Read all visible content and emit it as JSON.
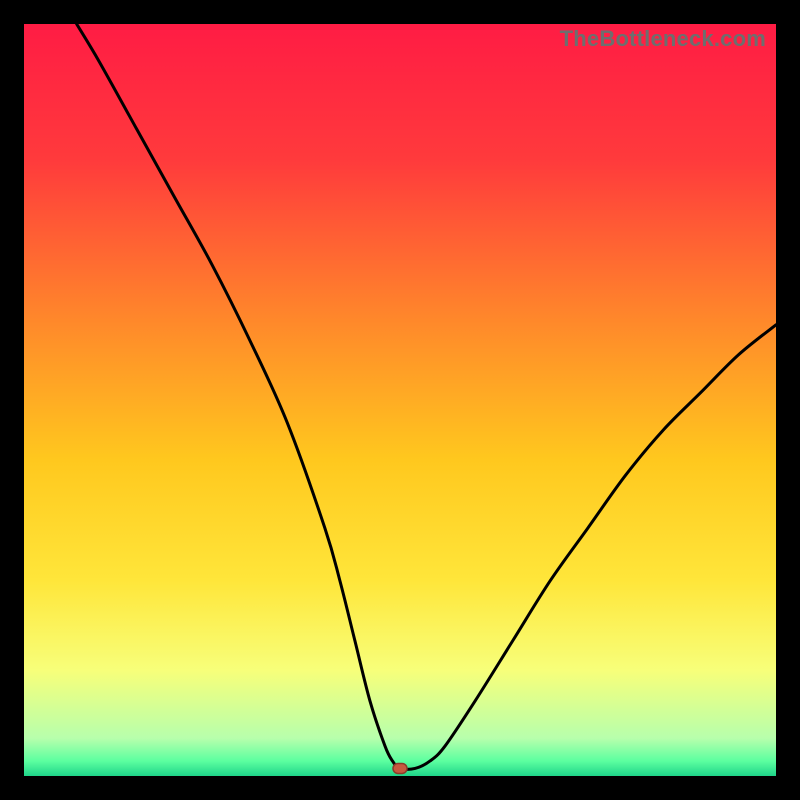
{
  "watermark": "TheBottleneck.com",
  "chart_data": {
    "type": "line",
    "title": "",
    "xlabel": "",
    "ylabel": "",
    "xlim": [
      0,
      100
    ],
    "ylim": [
      0,
      100
    ],
    "grid": false,
    "legend": false,
    "series": [
      {
        "name": "bottleneck-curve",
        "x": [
          7,
          10,
          15,
          20,
          25,
          30,
          35,
          40,
          42,
          44,
          46,
          48,
          49,
          50,
          52,
          54,
          56,
          60,
          65,
          70,
          75,
          80,
          85,
          90,
          95,
          100
        ],
        "y": [
          100,
          95,
          86,
          77,
          68,
          58,
          47,
          33,
          26,
          18,
          10,
          4,
          2,
          1,
          1,
          2,
          4,
          10,
          18,
          26,
          33,
          40,
          46,
          51,
          56,
          60
        ]
      }
    ],
    "marker": {
      "x": 50,
      "y": 1,
      "label": "optimal-point"
    },
    "gradient_stops": [
      {
        "pos": 0.0,
        "color": "#ff1c44"
      },
      {
        "pos": 0.18,
        "color": "#ff3a3c"
      },
      {
        "pos": 0.4,
        "color": "#ff8a2a"
      },
      {
        "pos": 0.58,
        "color": "#ffc81e"
      },
      {
        "pos": 0.74,
        "color": "#ffe63a"
      },
      {
        "pos": 0.86,
        "color": "#f7ff7a"
      },
      {
        "pos": 0.95,
        "color": "#b7ffac"
      },
      {
        "pos": 0.98,
        "color": "#5cffa0"
      },
      {
        "pos": 1.0,
        "color": "#1fd58a"
      }
    ]
  }
}
